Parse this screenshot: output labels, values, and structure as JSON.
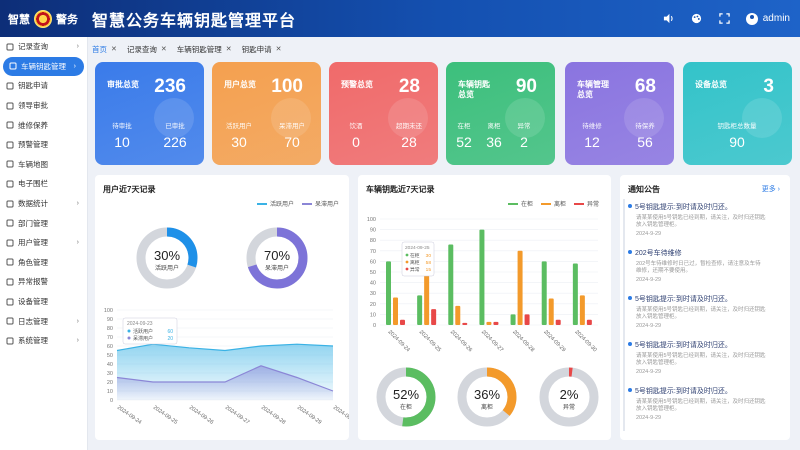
{
  "header": {
    "badge_left": "智慧",
    "badge_right": "警务",
    "title": "智慧公务车辆钥匙管理平台",
    "user": "admin"
  },
  "sidebar": {
    "items": [
      {
        "label": "记录查询",
        "icon": "file-icon",
        "expandable": true,
        "active": false
      },
      {
        "label": "车辆钥匙管理",
        "icon": "key-icon",
        "expandable": true,
        "active": true
      },
      {
        "label": "钥匙申请",
        "icon": "apply-icon",
        "expandable": false,
        "active": false
      },
      {
        "label": "领导审批",
        "icon": "approve-icon",
        "expandable": false,
        "active": false
      },
      {
        "label": "维修保养",
        "icon": "wrench-icon",
        "expandable": false,
        "active": false
      },
      {
        "label": "预警管理",
        "icon": "alert-icon",
        "expandable": false,
        "active": false
      },
      {
        "label": "车辆地图",
        "icon": "map-icon",
        "expandable": false,
        "active": false
      },
      {
        "label": "电子围栏",
        "icon": "fence-icon",
        "expandable": false,
        "active": false
      },
      {
        "label": "数据统计",
        "icon": "chart-icon",
        "expandable": true,
        "active": false
      },
      {
        "label": "部门管理",
        "icon": "dept-icon",
        "expandable": false,
        "active": false
      },
      {
        "label": "用户管理",
        "icon": "user-icon",
        "expandable": true,
        "active": false
      },
      {
        "label": "角色管理",
        "icon": "role-icon",
        "expandable": false,
        "active": false
      },
      {
        "label": "异常报警",
        "icon": "alarm-icon",
        "expandable": false,
        "active": false
      },
      {
        "label": "设备管理",
        "icon": "device-icon",
        "expandable": false,
        "active": false
      },
      {
        "label": "日志管理",
        "icon": "log-icon",
        "expandable": true,
        "active": false
      },
      {
        "label": "系统管理",
        "icon": "system-icon",
        "expandable": true,
        "active": false
      }
    ]
  },
  "tabs": [
    {
      "label": "首页",
      "closable": true,
      "current": true
    },
    {
      "label": "记录查询",
      "closable": true,
      "current": false
    },
    {
      "label": "车辆钥匙管理",
      "closable": true,
      "current": false
    },
    {
      "label": "钥匙申请",
      "closable": true,
      "current": false
    }
  ],
  "cards": [
    {
      "title": "审批总览",
      "value": "236",
      "color": "#3a7bea",
      "subs": [
        {
          "label": "待审批",
          "value": "10"
        },
        {
          "label": "已审批",
          "value": "226"
        }
      ]
    },
    {
      "title": "用户总览",
      "value": "100",
      "color": "#f4a04f",
      "subs": [
        {
          "label": "活跃用户",
          "value": "30"
        },
        {
          "label": "呆滞用户",
          "value": "70"
        }
      ]
    },
    {
      "title": "预警总览",
      "value": "28",
      "color": "#f06a6a",
      "subs": [
        {
          "label": "饮酒",
          "value": "0"
        },
        {
          "label": "超期未还",
          "value": "28"
        }
      ]
    },
    {
      "title": "车辆钥匙总览",
      "value": "90",
      "color": "#3cbf7c",
      "subs": [
        {
          "label": "在柜",
          "value": "52"
        },
        {
          "label": "离柜",
          "value": "36"
        },
        {
          "label": "异常",
          "value": "2"
        }
      ]
    },
    {
      "title": "车辆管理总览",
      "value": "68",
      "color": "#8a74e0",
      "subs": [
        {
          "label": "待维修",
          "value": "12"
        },
        {
          "label": "待保养",
          "value": "56"
        }
      ]
    },
    {
      "title": "设备总览",
      "value": "3",
      "color": "#33c3c9",
      "subs": [
        {
          "label": "钥匙柜总数量",
          "value": "90"
        }
      ]
    }
  ],
  "user_panel": {
    "title": "用户近7天记录",
    "legend": [
      {
        "name": "活跃用户",
        "color": "#3ab2e5"
      },
      {
        "name": "呆滞用户",
        "color": "#8b86d6"
      }
    ],
    "donuts": [
      {
        "value": "30%",
        "label": "活跃用户",
        "fraction": 0.3,
        "color": "#1e90e8"
      },
      {
        "value": "70%",
        "label": "呆滞用户",
        "fraction": 0.7,
        "color": "#7d73d8"
      }
    ],
    "tooltip": {
      "date": "2024-09-23",
      "rows": [
        {
          "name": "活跃用户",
          "value": "60"
        },
        {
          "name": "呆滞用户",
          "value": "20"
        }
      ]
    }
  },
  "key_panel": {
    "title": "车辆钥匙近7天记录",
    "legend": [
      {
        "name": "在柜",
        "color": "#5bbd61"
      },
      {
        "name": "离柜",
        "color": "#f39a2b"
      },
      {
        "name": "异常",
        "color": "#e84848"
      }
    ],
    "donuts": [
      {
        "value": "52%",
        "label": "在柜",
        "fraction": 0.52,
        "color": "#5bbd61"
      },
      {
        "value": "36%",
        "label": "离柜",
        "fraction": 0.36,
        "color": "#f39a2b"
      },
      {
        "value": "2%",
        "label": "异常",
        "fraction": 0.02,
        "color": "#e84848"
      }
    ],
    "tooltip": {
      "date": "2024-09-25",
      "rows": [
        {
          "name": "在柜",
          "value": "30"
        },
        {
          "name": "离柜",
          "value": "58"
        },
        {
          "name": "异常",
          "value": "15"
        }
      ]
    }
  },
  "notice": {
    "title": "通知公告",
    "more": "更多",
    "items": [
      {
        "title": "5号钥匙提示:到时请及时归还。",
        "desc": "请某某使用5号钥匙已经到期，请关注，及时归还钥匙放入钥匙管理柜。",
        "date": "2024-9-29"
      },
      {
        "title": "202号车待维修",
        "desc": "202号车待维修时日已过，暂检查修，请注意及车待维修，还期不要使用。",
        "date": "2024-9-29"
      },
      {
        "title": "5号钥匙提示:到时请及时归还。",
        "desc": "请某某使用5号钥匙已经到期，请关注，及时归还钥匙放入钥匙管理柜。",
        "date": "2024-9-29"
      },
      {
        "title": "5号钥匙提示:到时请及时归还。",
        "desc": "请某某使用5号钥匙已经到期，请关注，及时归还钥匙放入钥匙管理柜。",
        "date": "2024-9-29"
      },
      {
        "title": "5号钥匙提示:到时请及时归还。",
        "desc": "请某某使用5号钥匙已经到期，请关注，及时归还钥匙放入钥匙管理柜。",
        "date": "2024-9-29"
      }
    ]
  },
  "chart_data": [
    {
      "type": "area",
      "x": [
        "2024-09-24",
        "2024-09-25",
        "2024-09-26",
        "2024-09-27",
        "2024-09-28",
        "2024-09-29",
        "2024-09-30"
      ],
      "series": [
        {
          "name": "活跃用户",
          "values": [
            55,
            62,
            58,
            55,
            60,
            62,
            60
          ]
        },
        {
          "name": "呆滞用户",
          "values": [
            25,
            20,
            20,
            20,
            38,
            25,
            10
          ]
        }
      ],
      "ylim": [
        0,
        100
      ],
      "yticks": [
        0,
        10,
        20,
        30,
        40,
        50,
        60,
        70,
        80,
        90,
        100
      ]
    },
    {
      "type": "bar",
      "categories": [
        "2024-09-24",
        "2024-09-25",
        "2024-09-26",
        "2024-09-27",
        "2024-09-28",
        "2024-09-29",
        "2024-09-30"
      ],
      "series": [
        {
          "name": "在柜",
          "values": [
            60,
            28,
            76,
            90,
            10,
            60,
            58
          ]
        },
        {
          "name": "离柜",
          "values": [
            26,
            58,
            18,
            3,
            70,
            25,
            28
          ]
        },
        {
          "name": "异常",
          "values": [
            5,
            15,
            2,
            3,
            10,
            5,
            5
          ]
        }
      ],
      "ylim": [
        0,
        100
      ],
      "yticks": [
        0,
        10,
        20,
        30,
        40,
        50,
        60,
        70,
        80,
        90,
        100
      ]
    }
  ]
}
